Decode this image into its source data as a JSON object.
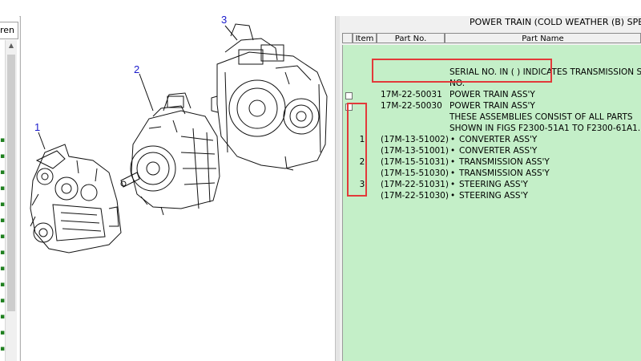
{
  "left_panel": {
    "tab_label": "ren",
    "scroll_up_symbol": "▲"
  },
  "drawing": {
    "callouts": [
      {
        "label": "1"
      },
      {
        "label": "2"
      },
      {
        "label": "3"
      }
    ]
  },
  "parts_list": {
    "title": "POWER TRAIN (COLD WEATHER (B) SPEC",
    "columns": {
      "item": "Item",
      "part_no": "Part No.",
      "part_name": "Part Name"
    },
    "rows": [
      {
        "item": "",
        "part_no": "",
        "part_name": "SERIAL NO. IN ( ) INDICATES TRANSMISSION S",
        "has_checkbox": false,
        "bullet": false
      },
      {
        "item": "",
        "part_no": "",
        "part_name": "NO.",
        "has_checkbox": false,
        "bullet": false
      },
      {
        "item": "",
        "part_no": "17M-22-50031",
        "part_name": "POWER TRAIN ASS'Y",
        "has_checkbox": true,
        "bullet": false
      },
      {
        "item": "",
        "part_no": "17M-22-50030",
        "part_name": "POWER TRAIN ASS'Y",
        "has_checkbox": true,
        "bullet": false
      },
      {
        "item": "",
        "part_no": "",
        "part_name": "THESE ASSEMBLIES CONSIST OF ALL PARTS",
        "has_checkbox": false,
        "bullet": false
      },
      {
        "item": "",
        "part_no": "",
        "part_name": "SHOWN IN FIGS F2300-51A1 TO F2300-61A1.",
        "has_checkbox": false,
        "bullet": false
      },
      {
        "item": "1",
        "part_no": "(17M-13-51002)",
        "part_name": "CONVERTER ASS'Y",
        "has_checkbox": false,
        "bullet": true
      },
      {
        "item": "",
        "part_no": "(17M-13-51001)",
        "part_name": "CONVERTER ASS'Y",
        "has_checkbox": false,
        "bullet": true
      },
      {
        "item": "2",
        "part_no": "(17M-15-51031)",
        "part_name": "TRANSMISSION ASS'Y",
        "has_checkbox": false,
        "bullet": true
      },
      {
        "item": "",
        "part_no": "(17M-15-51030)",
        "part_name": "TRANSMISSION ASS'Y",
        "has_checkbox": false,
        "bullet": true
      },
      {
        "item": "3",
        "part_no": "(17M-22-51031)",
        "part_name": "STEERING ASS'Y",
        "has_checkbox": false,
        "bullet": true
      },
      {
        "item": "",
        "part_no": "(17M-22-51030)",
        "part_name": "STEERING ASS'Y",
        "has_checkbox": false,
        "bullet": true
      }
    ],
    "bullet_symbol": "•"
  },
  "colors": {
    "table_bg": "#c4efc8",
    "callout": "#1a1acc",
    "highlight": "#e23a3a"
  }
}
